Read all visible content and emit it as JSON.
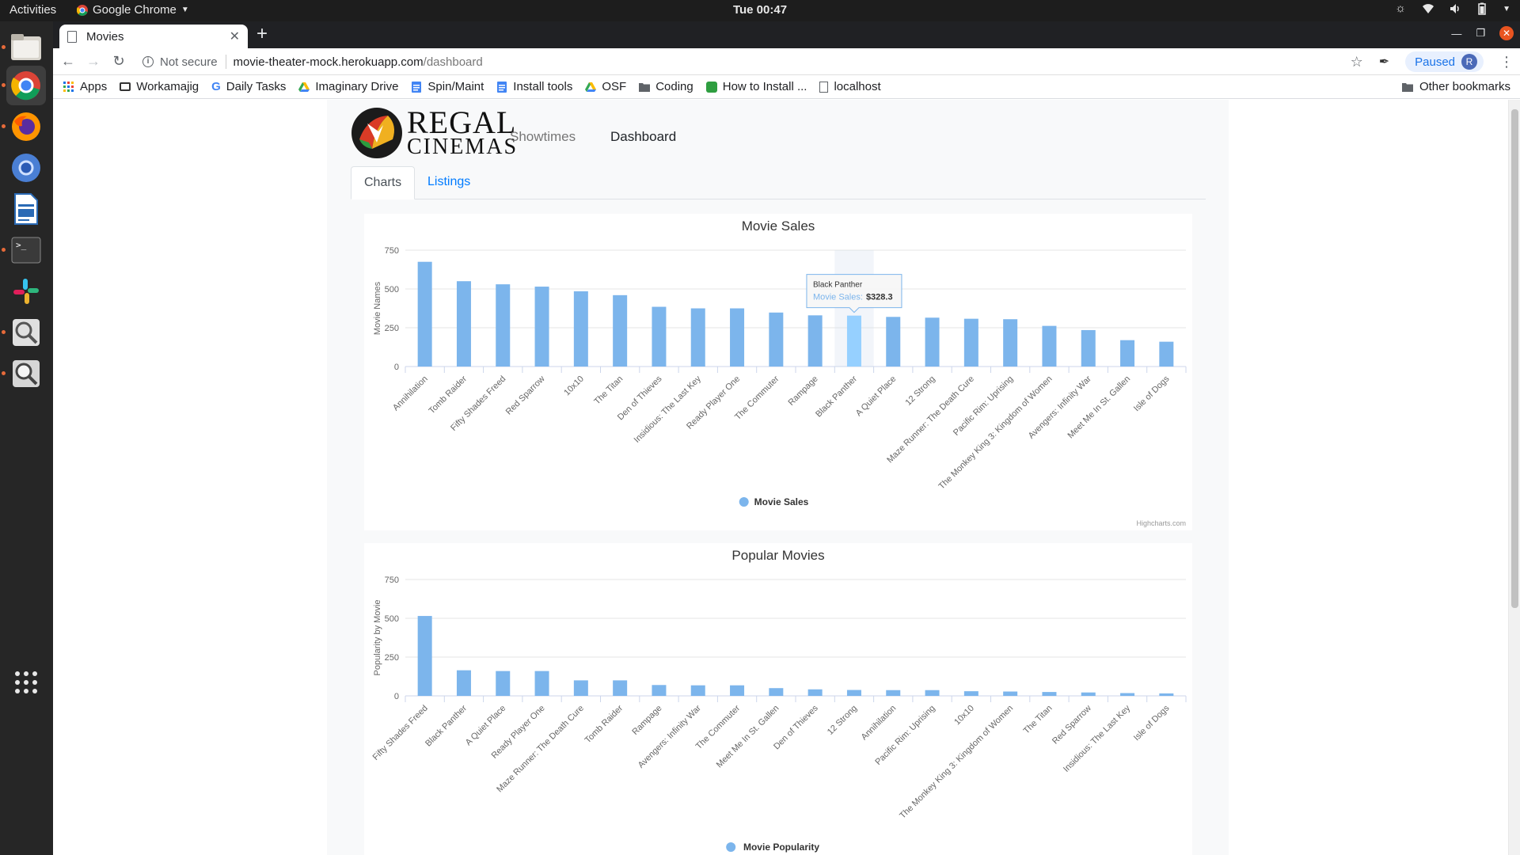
{
  "topbar": {
    "activities": "Activities",
    "app_name": "Google Chrome",
    "clock": "Tue 00:47"
  },
  "dock": {
    "items": [
      "files-icon",
      "chrome-icon",
      "firefox-icon",
      "chromium-icon",
      "writer-icon",
      "terminal-icon",
      "slack-icon",
      "screenshot-icon",
      "search-icon",
      "app-grid-icon"
    ]
  },
  "browser": {
    "tab_title": "Movies",
    "not_secure": "Not secure",
    "url_host": "movie-theater-mock.herokuapp.com",
    "url_path": "/dashboard",
    "paused": "Paused",
    "avatar_letter": "R",
    "bookmarks": [
      "Apps",
      "Workamajig",
      "Daily Tasks",
      "Imaginary Drive",
      "Spin/Maint",
      "Install tools",
      "OSF",
      "Coding",
      "How to Install ...",
      "localhost"
    ],
    "other_bookmarks": "Other bookmarks"
  },
  "page": {
    "logo_line1": "REGAL",
    "logo_line2": "CINEMAS",
    "nav": {
      "showtimes": "Showtimes",
      "dashboard": "Dashboard"
    },
    "tabs": {
      "charts": "Charts",
      "listings": "Listings"
    }
  },
  "chart_data": [
    {
      "type": "bar",
      "title": "Movie Sales",
      "ylabel": "Movie Names",
      "xlabel": "",
      "ylim": [
        0,
        750
      ],
      "yticks": [
        0,
        250,
        500,
        750
      ],
      "categories": [
        "Annihilation",
        "Tomb Raider",
        "Fifty Shades Freed",
        "Red Sparrow",
        "10x10",
        "The Titan",
        "Den of Thieves",
        "Insidious: The Last Key",
        "Ready Player One",
        "The Commuter",
        "Rampage",
        "Black Panther",
        "A Quiet Place",
        "12 Strong",
        "Maze Runner: The Death Cure",
        "Pacific Rim: Uprising",
        "The Monkey King 3: Kingdom of Women",
        "Avengers: Infinity War",
        "Meet Me In St. Gallen",
        "Isle of Dogs"
      ],
      "series": [
        {
          "name": "Movie Sales",
          "color": "#7cb5ec",
          "values": [
            675,
            550,
            530,
            515,
            485,
            460,
            385,
            375,
            375,
            348,
            330,
            328.3,
            320,
            315,
            308,
            305,
            262,
            235,
            170,
            160
          ]
        }
      ],
      "tooltip": {
        "category": "Black Panther",
        "series": "Movie Sales:",
        "value": "$328.3"
      },
      "credits": "Highcharts.com",
      "legend": "bottom-center",
      "grid": true
    },
    {
      "type": "bar",
      "title": "Popular Movies",
      "ylabel": "Popularity by Movie",
      "xlabel": "",
      "ylim": [
        0,
        750
      ],
      "yticks": [
        0,
        250,
        500,
        750
      ],
      "categories": [
        "Fifty Shades Freed",
        "Black Panther",
        "A Quiet Place",
        "Ready Player One",
        "Maze Runner: The Death Cure",
        "Tomb Raider",
        "Rampage",
        "Avengers: Infinity War",
        "The Commuter",
        "Meet Me In St. Gallen",
        "Den of Thieves",
        "12 Strong",
        "Annihilation",
        "Pacific Rim: Uprising",
        "10x10",
        "The Monkey King 3: Kingdom of Women",
        "The Titan",
        "Red Sparrow",
        "Insidious: The Last Key",
        "Isle of Dogs"
      ],
      "series": [
        {
          "name": "Movie Popularity",
          "color": "#7cb5ec",
          "values": [
            515,
            165,
            160,
            160,
            100,
            100,
            70,
            68,
            68,
            50,
            42,
            38,
            37,
            37,
            30,
            28,
            25,
            22,
            18,
            16
          ]
        }
      ],
      "legend": "bottom-center",
      "grid": true
    }
  ]
}
